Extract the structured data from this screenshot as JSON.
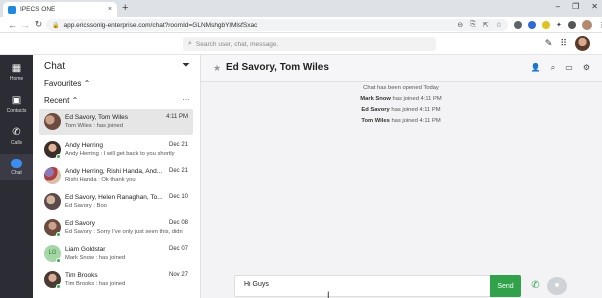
{
  "browser": {
    "tab_title": "IPECS ONE",
    "tab_close": "×",
    "new_tab": "+",
    "win_ctrls": [
      "–",
      "❐",
      "✕"
    ],
    "nav": {
      "back": "←",
      "forward": "→",
      "reload": "↻"
    },
    "url": "app.ericssonlg-enterprise.com/chat?roomId=GLNMshgbYlMlsfSxac"
  },
  "app_header": {
    "search_placeholder": "Search user, chat, message."
  },
  "leftnav": {
    "items": [
      {
        "label": "Home",
        "icon": "grid-icon"
      },
      {
        "label": "Contacts",
        "icon": "contacts-icon"
      },
      {
        "label": "Calls",
        "icon": "phone-icon"
      },
      {
        "label": "Chat",
        "icon": "chat-icon"
      }
    ]
  },
  "chat_panel": {
    "title": "Chat",
    "favourites_label": "Favourites",
    "recent_label": "Recent",
    "more": "···",
    "items": [
      {
        "name": "Ed Savory, Tom Wiles",
        "sub": "Tom Wiles : has joined",
        "date": "4:11 PM",
        "selected": true
      },
      {
        "name": "Andy Herring",
        "sub": "Andy Herring : I will get back to you shortly",
        "date": "Dec 21"
      },
      {
        "name": "Andy Herring, Rishi Handa, And...",
        "sub": "Rishi Handa : Ok thank you",
        "date": "Dec 21"
      },
      {
        "name": "Ed Savory, Helen Ranaghan, To...",
        "sub": "Ed Savory : Boo",
        "date": "Dec 10"
      },
      {
        "name": "Ed Savory",
        "sub": "Ed Savory : Sorry I've only just seen this, didn't ...",
        "date": "Dec 08"
      },
      {
        "name": "Liam Goldstar",
        "sub": "Mark Snow : has joined",
        "date": "Dec 07"
      },
      {
        "name": "Tim Brooks",
        "sub": "Tim Brooks : has joined",
        "date": "Nov 27"
      }
    ]
  },
  "conversation": {
    "title": "Ed Savory, Tom Wiles",
    "system_messages": [
      {
        "who": "",
        "text": "Chat has been opened Today"
      },
      {
        "who": "Mark Snow",
        "text": " has joined 4:11 PM"
      },
      {
        "who": "Ed Savory",
        "text": " has joined 4:11 PM"
      },
      {
        "who": "Tom Wiles",
        "text": " has joined 4:11 PM"
      }
    ],
    "composer_value": "Hi Guys",
    "send_label": "Send"
  },
  "colors": {
    "accent_green": "#2fa24a",
    "nav_bg": "#2b2c34",
    "chat_active": "#3b8df0"
  }
}
